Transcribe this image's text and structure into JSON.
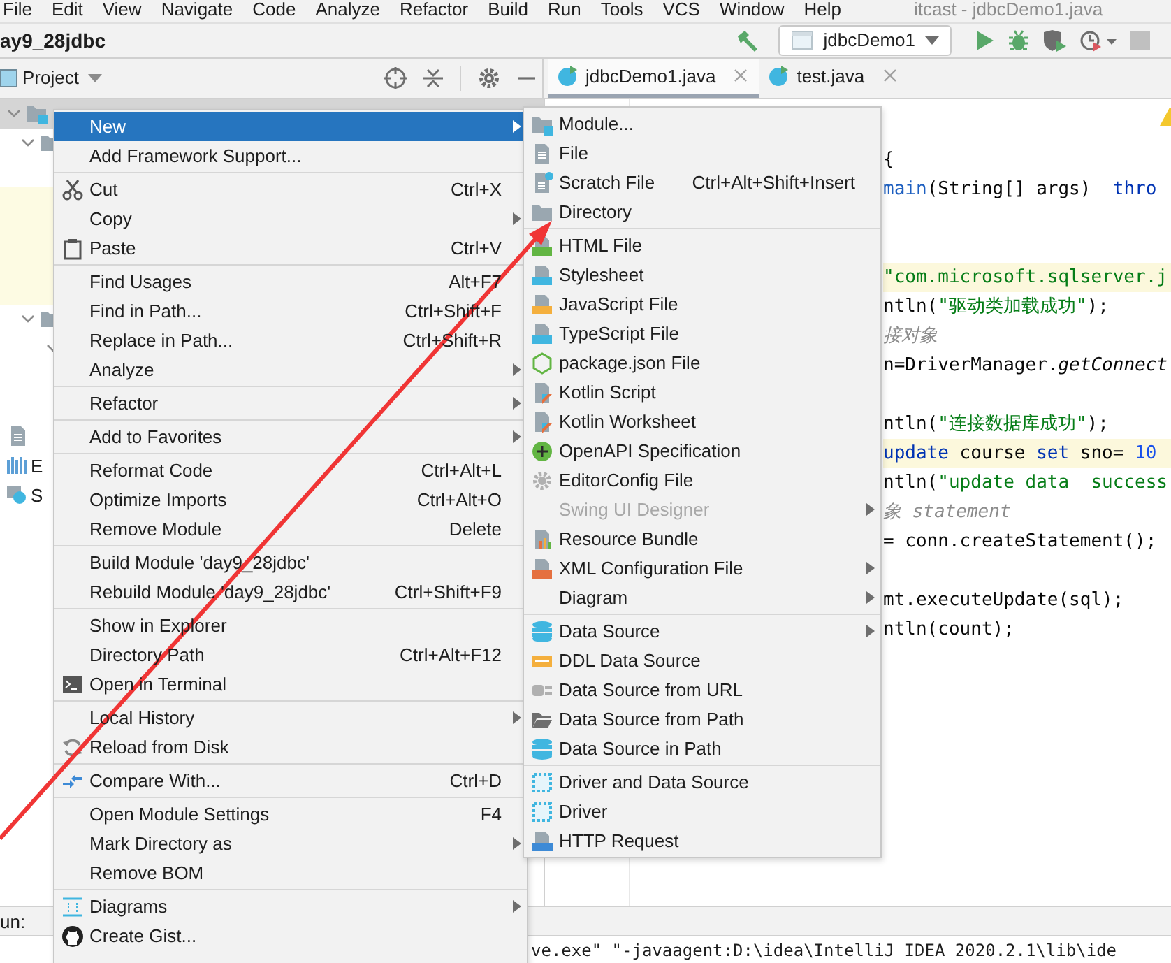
{
  "menu_bar": [
    "File",
    "Edit",
    "View",
    "Navigate",
    "Code",
    "Analyze",
    "Refactor",
    "Build",
    "Run",
    "Tools",
    "VCS",
    "Window",
    "Help"
  ],
  "window_title": "itcast - jdbcDemo1.java",
  "nav_bar": {
    "project": "ay9_28jdbc",
    "run_config": "jdbcDemo1"
  },
  "project_panel": {
    "title": "Project",
    "rows": [
      {
        "expanded": true,
        "selected": true
      },
      {
        "expanded": true,
        "selected": false
      },
      {
        "selected": false
      },
      {
        "selected": false,
        "highlighted": true
      },
      {
        "selected": false,
        "highlighted": true
      },
      {
        "selected": false,
        "highlighted": true
      },
      {
        "selected": false,
        "highlighted": true
      },
      {
        "expanded": true,
        "selected": false
      },
      {
        "expanded": true,
        "selected": false
      },
      {
        "selected": false
      },
      {
        "selected": false
      },
      {
        "selected": false
      },
      {
        "selected": false,
        "label": "E"
      },
      {
        "selected": false,
        "label": "S"
      }
    ]
  },
  "editor_tabs": [
    {
      "label": "jdbcDemo1.java",
      "selected": true
    },
    {
      "label": "test.java",
      "selected": false
    }
  ],
  "editor": {
    "lines": [
      {
        "highlighted": false
      },
      {
        "highlighted": false,
        "segments": [
          {
            "text": "{",
            "kind": "plain"
          }
        ]
      },
      {
        "highlighted": false,
        "segments": [
          {
            "text": "main",
            "kind": "method"
          },
          {
            "text": "(String[] args)  ",
            "kind": "plain"
          },
          {
            "text": "thro",
            "kind": "keyword"
          }
        ]
      },
      {
        "highlighted": false
      },
      {
        "highlighted": false
      },
      {
        "highlighted": true,
        "segments": [
          {
            "text": "\"com.microsoft.sqlserver.j",
            "kind": "string"
          }
        ]
      },
      {
        "highlighted": false,
        "segments": [
          {
            "text": "ntln(",
            "kind": "plain"
          },
          {
            "text": "\"驱动类加载成功\"",
            "kind": "string"
          },
          {
            "text": ");",
            "kind": "plain"
          }
        ]
      },
      {
        "highlighted": false,
        "segments": [
          {
            "text": "接对象",
            "kind": "comment"
          }
        ]
      },
      {
        "highlighted": false,
        "segments": [
          {
            "text": "n=DriverManager.",
            "kind": "plain"
          },
          {
            "text": "getConnect",
            "kind": "static"
          }
        ]
      },
      {
        "highlighted": false
      },
      {
        "highlighted": false,
        "segments": [
          {
            "text": "ntln(",
            "kind": "plain"
          },
          {
            "text": "\"连接数据库成功\"",
            "kind": "string"
          },
          {
            "text": ");",
            "kind": "plain"
          }
        ]
      },
      {
        "highlighted": true,
        "segments": [
          {
            "text": "update",
            "kind": "keyword"
          },
          {
            "text": " course ",
            "kind": "plain"
          },
          {
            "text": "set",
            "kind": "keyword"
          },
          {
            "text": " sno= ",
            "kind": "plain"
          },
          {
            "text": "10",
            "kind": "number"
          }
        ]
      },
      {
        "highlighted": false,
        "segments": [
          {
            "text": "ntln(",
            "kind": "plain"
          },
          {
            "text": "\"update data  success",
            "kind": "string"
          }
        ]
      },
      {
        "highlighted": false,
        "segments": [
          {
            "text": "象 statement",
            "kind": "comment"
          }
        ]
      },
      {
        "highlighted": false,
        "segments": [
          {
            "text": "= conn.createStatement();",
            "kind": "plain"
          }
        ]
      },
      {
        "highlighted": false
      },
      {
        "highlighted": false,
        "segments": [
          {
            "text": "mt.executeUpdate(sql);",
            "kind": "plain"
          }
        ]
      },
      {
        "highlighted": false,
        "segments": [
          {
            "text": "ntln(count);",
            "kind": "plain"
          }
        ]
      }
    ]
  },
  "run_panel": {
    "label": "un:",
    "console": "ve.exe\" \"-javaagent:D:\\idea\\IntelliJ IDEA 2020.2.1\\lib\\ide"
  },
  "context_menu": {
    "groups": [
      [
        {
          "label": "New",
          "selected": true,
          "has_submenu": true
        },
        {
          "label": "Add Framework Support...",
          "selected": false
        }
      ],
      [
        {
          "label": "Cut",
          "shortcut": "Ctrl+X",
          "selected": false
        },
        {
          "label": "Copy",
          "selected": false,
          "has_submenu": true
        },
        {
          "label": "Paste",
          "shortcut": "Ctrl+V",
          "selected": false
        }
      ],
      [
        {
          "label": "Find Usages",
          "shortcut": "Alt+F7",
          "selected": false
        },
        {
          "label": "Find in Path...",
          "shortcut": "Ctrl+Shift+F",
          "selected": false
        },
        {
          "label": "Replace in Path...",
          "shortcut": "Ctrl+Shift+R",
          "selected": false
        },
        {
          "label": "Analyze",
          "selected": false,
          "has_submenu": true
        }
      ],
      [
        {
          "label": "Refactor",
          "selected": false,
          "has_submenu": true
        }
      ],
      [
        {
          "label": "Add to Favorites",
          "selected": false,
          "has_submenu": true
        }
      ],
      [
        {
          "label": "Reformat Code",
          "shortcut": "Ctrl+Alt+L",
          "selected": false
        },
        {
          "label": "Optimize Imports",
          "shortcut": "Ctrl+Alt+O",
          "selected": false
        },
        {
          "label": "Remove Module",
          "shortcut": "Delete",
          "selected": false
        }
      ],
      [
        {
          "label": "Build Module 'day9_28jdbc'",
          "selected": false
        },
        {
          "label": "Rebuild Module 'day9_28jdbc'",
          "shortcut": "Ctrl+Shift+F9",
          "selected": false
        }
      ],
      [
        {
          "label": "Show in Explorer",
          "selected": false
        },
        {
          "label": "Directory Path",
          "shortcut": "Ctrl+Alt+F12",
          "selected": false
        },
        {
          "label": "Open in Terminal",
          "selected": false
        }
      ],
      [
        {
          "label": "Local History",
          "selected": false,
          "has_submenu": true
        },
        {
          "label": "Reload from Disk",
          "selected": false
        }
      ],
      [
        {
          "label": "Compare With...",
          "shortcut": "Ctrl+D",
          "selected": false
        }
      ],
      [
        {
          "label": "Open Module Settings",
          "shortcut": "F4",
          "selected": false
        },
        {
          "label": "Mark Directory as",
          "selected": false,
          "has_submenu": true
        },
        {
          "label": "Remove BOM",
          "selected": false
        }
      ],
      [
        {
          "label": "Diagrams",
          "selected": false,
          "has_submenu": true
        },
        {
          "label": "Create Gist...",
          "selected": false
        }
      ]
    ]
  },
  "new_submenu": {
    "groups": [
      [
        {
          "label": "Module...",
          "selected": false,
          "disabled": false
        },
        {
          "label": "File",
          "selected": false,
          "disabled": false
        },
        {
          "label": "Scratch File",
          "shortcut": "Ctrl+Alt+Shift+Insert",
          "selected": false,
          "disabled": false
        },
        {
          "label": "Directory",
          "selected": false,
          "disabled": false
        }
      ],
      [
        {
          "label": "HTML File",
          "selected": false,
          "disabled": false
        },
        {
          "label": "Stylesheet",
          "selected": false,
          "disabled": false
        },
        {
          "label": "JavaScript File",
          "selected": false,
          "disabled": false
        },
        {
          "label": "TypeScript File",
          "selected": false,
          "disabled": false
        },
        {
          "label": "package.json File",
          "selected": false,
          "disabled": false
        },
        {
          "label": "Kotlin Script",
          "selected": false,
          "disabled": false
        },
        {
          "label": "Kotlin Worksheet",
          "selected": false,
          "disabled": false
        },
        {
          "label": "OpenAPI Specification",
          "selected": false,
          "disabled": false
        },
        {
          "label": "EditorConfig File",
          "selected": false,
          "disabled": false
        },
        {
          "label": "Swing UI Designer",
          "selected": false,
          "disabled": true,
          "has_submenu": true
        },
        {
          "label": "Resource Bundle",
          "selected": false,
          "disabled": false
        },
        {
          "label": "XML Configuration File",
          "selected": false,
          "disabled": false,
          "has_submenu": true
        },
        {
          "label": "Diagram",
          "selected": false,
          "disabled": false,
          "has_submenu": true
        }
      ],
      [
        {
          "label": "Data Source",
          "selected": false,
          "disabled": false,
          "has_submenu": true
        },
        {
          "label": "DDL Data Source",
          "selected": false,
          "disabled": false
        },
        {
          "label": "Data Source from URL",
          "selected": false,
          "disabled": false
        },
        {
          "label": "Data Source from Path",
          "selected": false,
          "disabled": false
        },
        {
          "label": "Data Source in Path",
          "selected": false,
          "disabled": false
        }
      ],
      [
        {
          "label": "Driver and Data Source",
          "selected": false,
          "disabled": false
        },
        {
          "label": "Driver",
          "selected": false,
          "disabled": false
        },
        {
          "label": "HTTP Request",
          "selected": false,
          "disabled": false
        }
      ]
    ]
  }
}
